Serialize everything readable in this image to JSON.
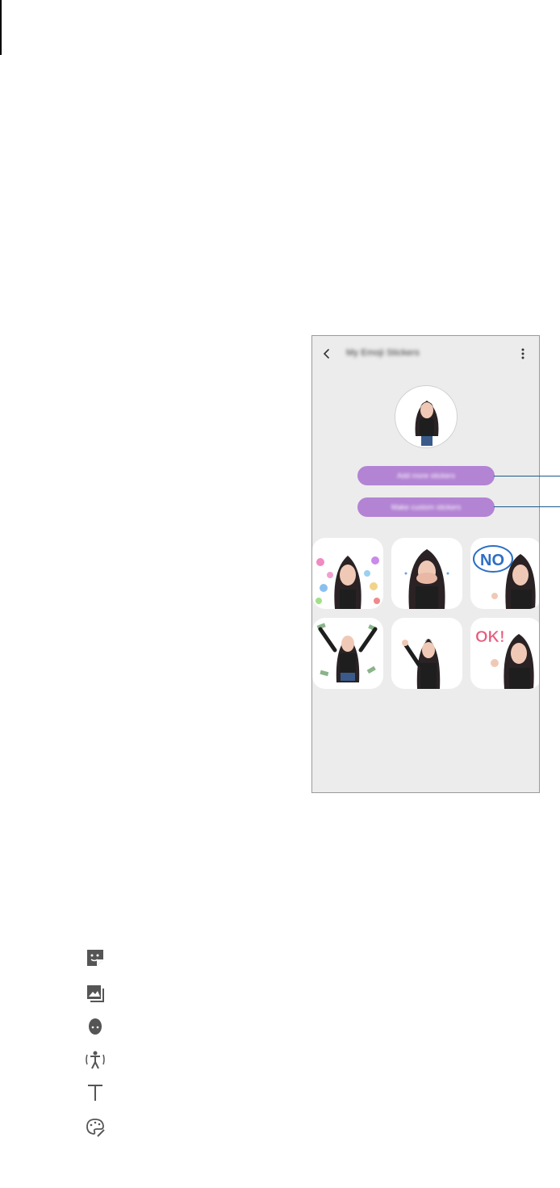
{
  "phone": {
    "app_title": "My Emoji Stickers",
    "icons": {
      "back": "chevron-left-icon",
      "more": "more-vert-icon"
    },
    "buttons": {
      "add_more": "Add more stickers",
      "make_custom": "Make custom stickers"
    },
    "button_color": "#b383d4",
    "stickers": [
      {
        "name": "hearts"
      },
      {
        "name": "covering-face"
      },
      {
        "name": "no"
      },
      {
        "name": "money-rain"
      },
      {
        "name": "waving"
      },
      {
        "name": "ok"
      }
    ]
  },
  "legend_icons": [
    {
      "icon": "sticker-icon"
    },
    {
      "icon": "gallery-icon"
    },
    {
      "icon": "face-icon"
    },
    {
      "icon": "body-icon"
    },
    {
      "icon": "text-icon"
    },
    {
      "icon": "palette-icon"
    }
  ],
  "accent_line_color": "#1d5a8a"
}
